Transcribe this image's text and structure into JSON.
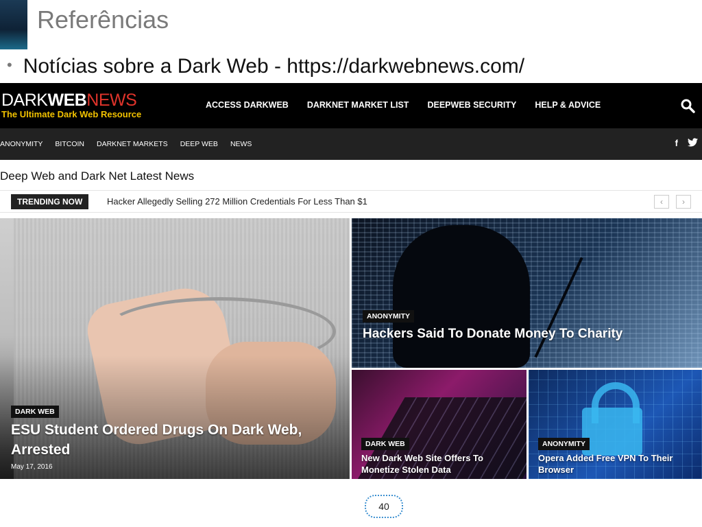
{
  "slide": {
    "title": "Referências",
    "bullet": "Notícias sobre a Dark Web - https://darkwebnews.com/",
    "page_number": "40"
  },
  "site": {
    "logo": {
      "dark": "DARK",
      "web": "WEB",
      "news": "NEWS",
      "tagline": "The Ultimate Dark Web Resource"
    },
    "main_nav": [
      "ACCESS DARKWEB",
      "DARKNET MARKET LIST",
      "DEEPWEB SECURITY",
      "HELP & ADVICE"
    ],
    "sub_nav": [
      "ANONYMITY",
      "BITCOIN",
      "DARKNET MARKETS",
      "DEEP WEB",
      "NEWS"
    ],
    "social": {
      "facebook": "f",
      "twitter": "t"
    },
    "headline": "Deep Web and Dark Net Latest News",
    "trending": {
      "badge": "TRENDING NOW",
      "text": "Hacker Allegedly Selling 272 Million Credentials For Less Than $1",
      "prev": "‹",
      "next": "›"
    },
    "cards": [
      {
        "category": "DARK WEB",
        "title": "ESU Student Ordered Drugs On Dark Web, Arrested",
        "date": "May 17, 2016"
      },
      {
        "category": "ANONYMITY",
        "title": "Hackers Said To Donate Money To Charity"
      },
      {
        "category": "DARK WEB",
        "title": "New Dark Web Site Offers To Monetize Stolen Data"
      },
      {
        "category": "ANONYMITY",
        "title": "Opera Added Free VPN To Their Browser"
      }
    ]
  },
  "colors": {
    "logo_news": "#e0342b",
    "tagline": "#f2c200",
    "topbar": "#000000",
    "subbar": "#222222",
    "page_number_border": "#3a8fd0"
  }
}
